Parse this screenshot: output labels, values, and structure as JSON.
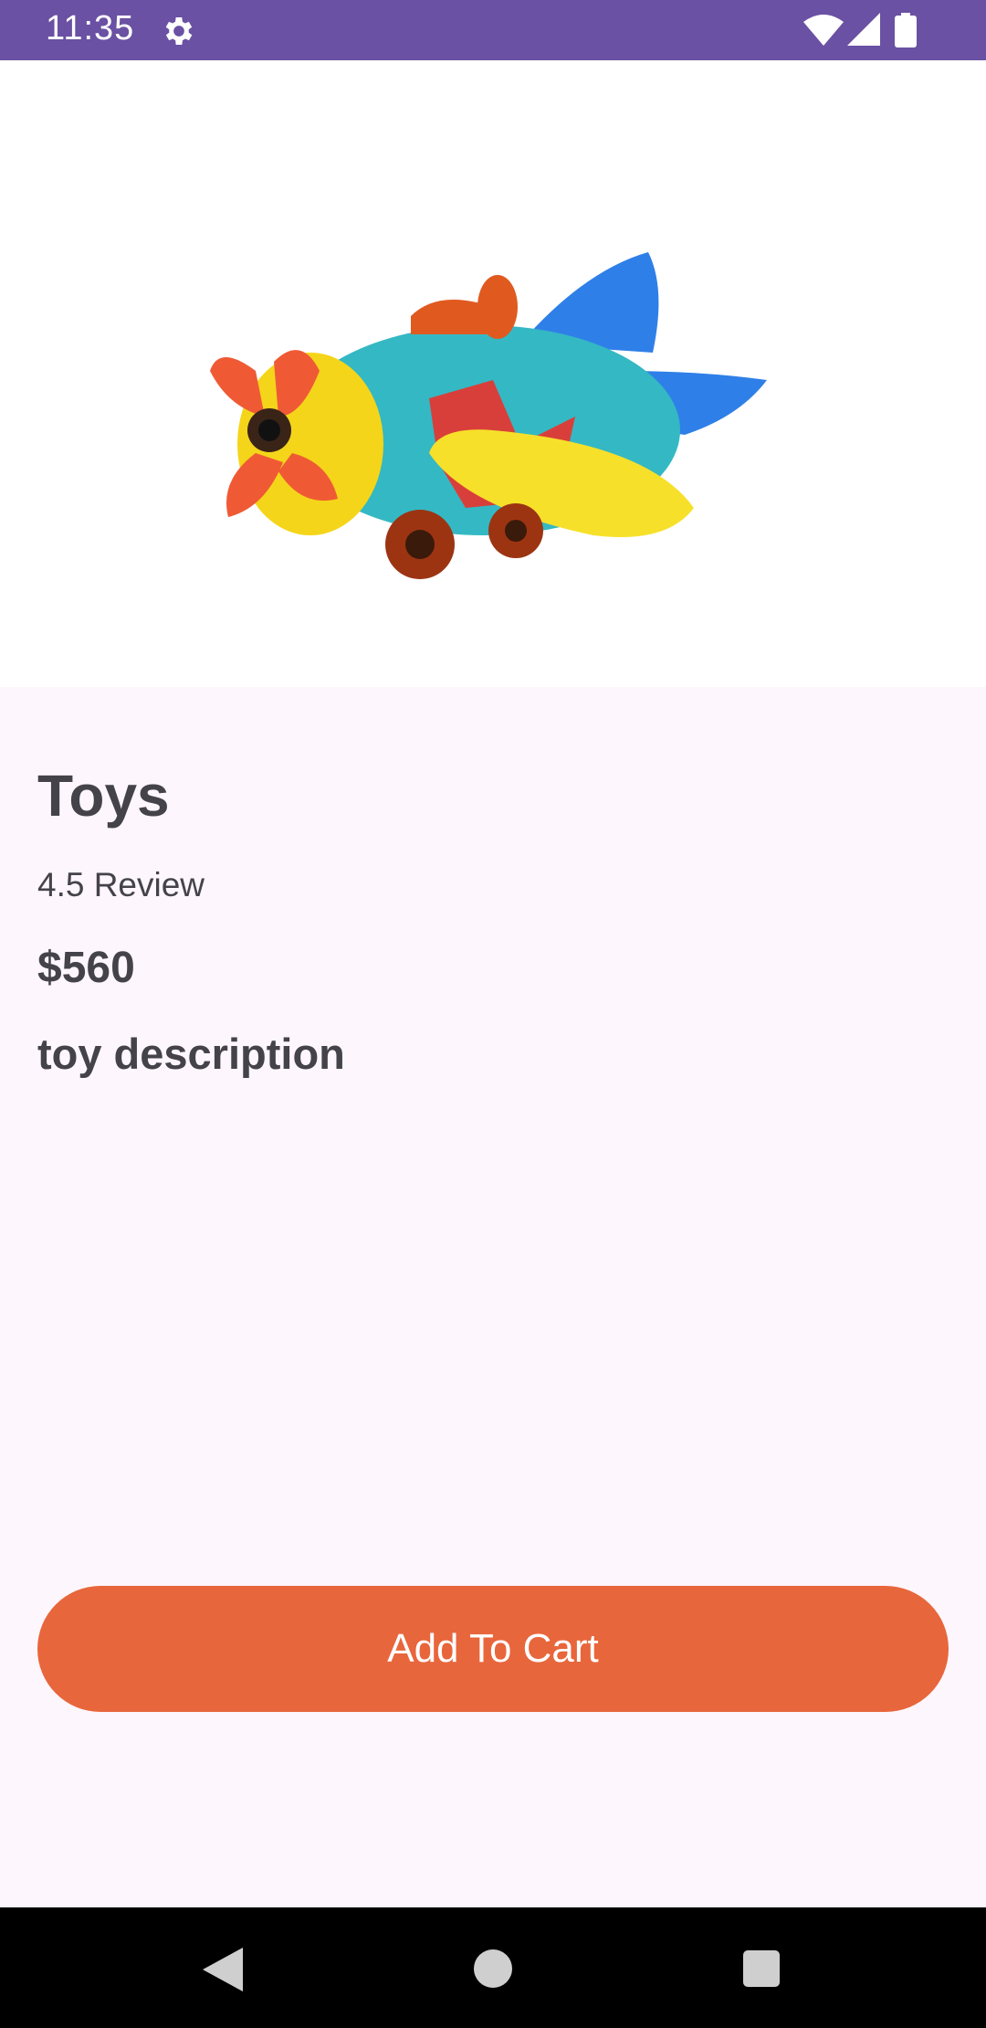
{
  "status_bar": {
    "time": "11:35",
    "icons": [
      "gear-icon",
      "wifi-icon",
      "signal-icon",
      "battery-icon"
    ],
    "background": "#6a51a3"
  },
  "product": {
    "image_icon": "toy-airplane-image",
    "name": "Toys",
    "review": "4.5 Review",
    "price": "$560",
    "description": "toy description"
  },
  "actions": {
    "add_to_cart_label": "Add To Cart",
    "button_color": "#e8663c"
  },
  "nav_bar": {
    "icons": [
      "back-icon",
      "home-icon",
      "recents-icon"
    ]
  }
}
